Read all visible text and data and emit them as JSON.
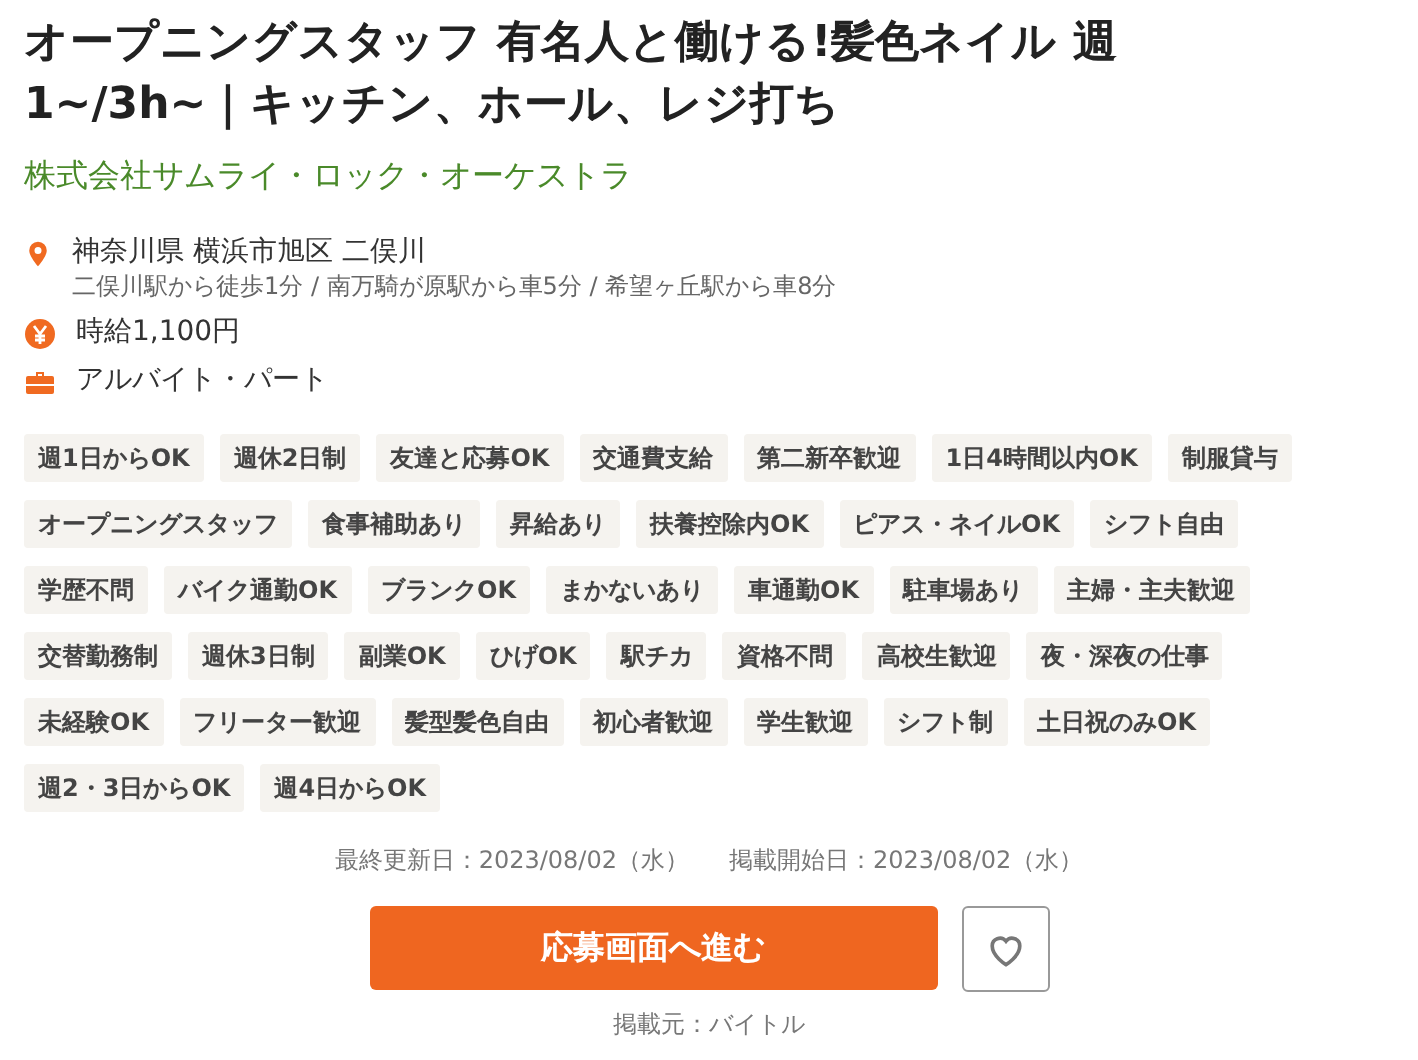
{
  "job": {
    "title": "オープニングスタッフ 有名人と働ける!髪色ネイル 週1~/3h~｜キッチン、ホール、レジ打ち",
    "company": "株式会社サムライ・ロック・オーケストラ",
    "details": [
      {
        "kind": "location",
        "text": "神奈川県 横浜市旭区 二俣川",
        "subtext": "二俣川駅から徒歩1分 / 南万騎が原駅から車5分 / 希望ヶ丘駅から車8分"
      },
      {
        "kind": "wage",
        "text": "時給1,100円"
      },
      {
        "kind": "employment",
        "text": "アルバイト・パート"
      }
    ],
    "tags": [
      "週1日からOK",
      "週休2日制",
      "友達と応募OK",
      "交通費支給",
      "第二新卒歓迎",
      "1日4時間以内OK",
      "制服貸与",
      "オープニングスタッフ",
      "食事補助あり",
      "昇給あり",
      "扶養控除内OK",
      "ピアス・ネイルOK",
      "シフト自由",
      "学歴不問",
      "バイク通勤OK",
      "ブランクOK",
      "まかないあり",
      "車通勤OK",
      "駐車場あり",
      "主婦・主夫歓迎",
      "交替勤務制",
      "週休3日制",
      "副業OK",
      "ひげOK",
      "駅チカ",
      "資格不問",
      "高校生歓迎",
      "夜・深夜の仕事",
      "未経験OK",
      "フリーター歓迎",
      "髪型髪色自由",
      "初心者歓迎",
      "学生歓迎",
      "シフト制",
      "土日祝のみOK",
      "週2・3日からOK",
      "週4日からOK"
    ],
    "dates": [
      "最終更新日：2023/08/02（水）",
      "掲載開始日：2023/08/02（水）"
    ],
    "apply_button": "応募画面へ進む",
    "favorite": {
      "selected": false
    },
    "source": "掲載元：バイトル"
  }
}
